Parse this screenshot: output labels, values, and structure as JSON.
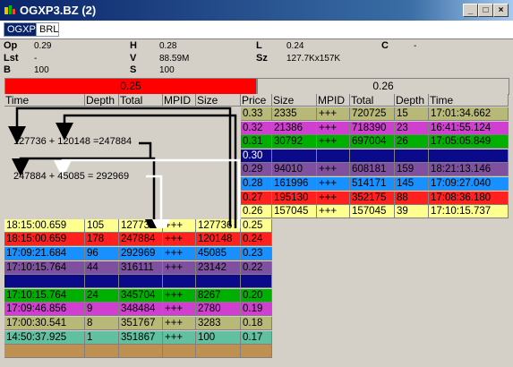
{
  "window": {
    "title": "OGXP3.BZ (2)",
    "minimize": "_",
    "maximize": "□",
    "close": "×"
  },
  "symbol": {
    "value": "OGXP3",
    "currency": "BRL"
  },
  "quote": {
    "op_label": "Op",
    "op": "0.29",
    "lst_label": "Lst",
    "lst": "-",
    "b_label": "B",
    "b": "100",
    "h_label": "H",
    "h": "0.28",
    "v_label": "V",
    "v": "88.59M",
    "s_label": "S",
    "s": "100",
    "l_label": "L",
    "l": "0.24",
    "sz_label": "Sz",
    "sz": "127.7Kx157K",
    "c_label": "C",
    "c": "-"
  },
  "bid_price": "0.25",
  "ask_price": "0.26",
  "bid_headers": [
    "Time",
    "Depth",
    "Total",
    "MPID",
    "Size",
    "Price"
  ],
  "ask_headers": [
    "Size",
    "MPID",
    "Total",
    "Depth",
    "Time"
  ],
  "annotations": {
    "sum1": "127736 + 120148 =247884",
    "sum2": "247884 + 45085 = 292969"
  },
  "ask_rows": [
    {
      "price": "0.33",
      "size": "2335",
      "mpid": "+++",
      "total": "720725",
      "depth": "15",
      "time": "17:01:34.662",
      "color": "#b8b878"
    },
    {
      "price": "0.32",
      "size": "21386",
      "mpid": "+++",
      "total": "718390",
      "depth": "23",
      "time": "16:41:55.124",
      "color": "#d040d0"
    },
    {
      "price": "0.31",
      "size": "30792",
      "mpid": "+++",
      "total": "697004",
      "depth": "26",
      "time": "17:05:05.849",
      "color": "#00b000"
    },
    {
      "price": "0.30",
      "size": "",
      "mpid": "",
      "total": "",
      "depth": "",
      "time": "",
      "color": "#0a0a8a"
    },
    {
      "price": "0.29",
      "size": "94010",
      "mpid": "+++",
      "total": "608181",
      "depth": "159",
      "time": "18:21:13.146",
      "color": "#8050a0"
    },
    {
      "price": "0.28",
      "size": "161996",
      "mpid": "+++",
      "total": "514171",
      "depth": "145",
      "time": "17:09:27.040",
      "color": "#1890ff"
    },
    {
      "price": "0.27",
      "size": "195130",
      "mpid": "+++",
      "total": "352175",
      "depth": "88",
      "time": "17:08:36.180",
      "color": "#ff2020"
    },
    {
      "price": "0.26",
      "size": "157045",
      "mpid": "+++",
      "total": "157045",
      "depth": "39",
      "time": "17:10:15.737",
      "color": "#ffff90"
    }
  ],
  "bid_rows": [
    {
      "time": "18:15:00.659",
      "depth": "105",
      "total": "127736",
      "mpid": "+++",
      "size": "127736",
      "price": "0.25",
      "color": "#ffff90"
    },
    {
      "time": "18:15:00.659",
      "depth": "178",
      "total": "247884",
      "mpid": "+++",
      "size": "120148",
      "price": "0.24",
      "color": "#ff2020"
    },
    {
      "time": "17:09:21.684",
      "depth": "96",
      "total": "292969",
      "mpid": "+++",
      "size": "45085",
      "price": "0.23",
      "color": "#1890ff"
    },
    {
      "time": "17:10:15.764",
      "depth": "44",
      "total": "316111",
      "mpid": "+++",
      "size": "23142",
      "price": "0.22",
      "color": "#8050a0"
    },
    {
      "time": "",
      "depth": "",
      "total": "",
      "mpid": "",
      "size": "",
      "price": "",
      "color": "#0a0a8a"
    },
    {
      "time": "17:10:15.764",
      "depth": "24",
      "total": "345704",
      "mpid": "+++",
      "size": "8267",
      "price": "0.20",
      "color": "#00b000"
    },
    {
      "time": "17:09:46.856",
      "depth": "9",
      "total": "348484",
      "mpid": "+++",
      "size": "2780",
      "price": "0.19",
      "color": "#d040d0"
    },
    {
      "time": "17:00:30.541",
      "depth": "8",
      "total": "351767",
      "mpid": "+++",
      "size": "3283",
      "price": "0.18",
      "color": "#b8b878"
    },
    {
      "time": "14:50:37.925",
      "depth": "1",
      "total": "351867",
      "mpid": "+++",
      "size": "100",
      "price": "0.17",
      "color": "#60c0a0"
    },
    {
      "time": "",
      "depth": "",
      "total": "",
      "mpid": "",
      "size": "",
      "price": "",
      "color": "#c09050"
    }
  ]
}
